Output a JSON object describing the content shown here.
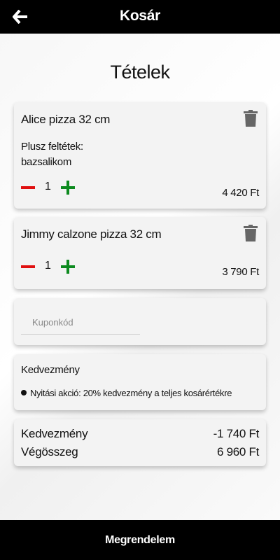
{
  "header": {
    "title": "Kosár",
    "back_icon": "arrow-left-icon"
  },
  "section_title": "Tételek",
  "items": [
    {
      "name": "Alice pizza 32 cm",
      "extras_label": "Plusz feltétek:",
      "extras_value": "bazsalikom",
      "quantity": "1",
      "price": "4 420 Ft"
    },
    {
      "name": "Jimmy calzone pizza 32 cm",
      "quantity": "1",
      "price": "3 790 Ft"
    }
  ],
  "coupon": {
    "placeholder": "Kuponkód",
    "value": ""
  },
  "discount_box": {
    "title": "Kedvezmény",
    "entry": "Nyitási akció: 20% kedvezmény a teljes kosárértékre"
  },
  "summary": {
    "discount_label": "Kedvezmény",
    "discount_value": "-1 740 Ft",
    "total_label": "Végösszeg",
    "total_value": "6 960 Ft"
  },
  "footer": {
    "order_label": "Megrendelem"
  },
  "colors": {
    "minus": "#e01010",
    "plus": "#0d8a1f",
    "bar": "#000000"
  }
}
